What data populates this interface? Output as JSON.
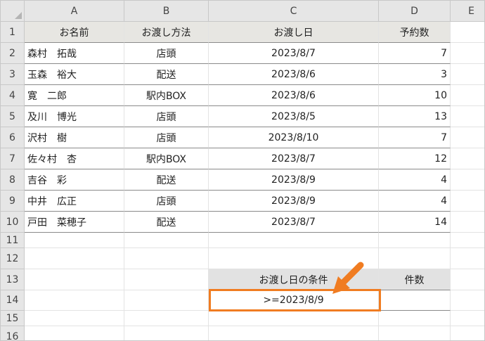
{
  "columns": [
    "A",
    "B",
    "C",
    "D",
    "E"
  ],
  "rows": [
    "1",
    "2",
    "3",
    "4",
    "5",
    "6",
    "7",
    "8",
    "9",
    "10",
    "11",
    "12",
    "13",
    "14",
    "15",
    "16"
  ],
  "table": {
    "headers": [
      "お名前",
      "お渡し方法",
      "お渡し日",
      "予約数"
    ],
    "records": [
      {
        "name": "森村　拓哉",
        "method": "店頭",
        "date": "2023/8/7",
        "count": "7"
      },
      {
        "name": "玉森　裕大",
        "method": "配送",
        "date": "2023/8/6",
        "count": "3"
      },
      {
        "name": "寛　二郎",
        "method": "駅内BOX",
        "date": "2023/8/6",
        "count": "10"
      },
      {
        "name": "及川　博光",
        "method": "店頭",
        "date": "2023/8/5",
        "count": "13"
      },
      {
        "name": "沢村　樹",
        "method": "店頭",
        "date": "2023/8/10",
        "count": "7"
      },
      {
        "name": "佐々村　杏",
        "method": "駅内BOX",
        "date": "2023/8/7",
        "count": "12"
      },
      {
        "name": "吉谷　彩",
        "method": "配送",
        "date": "2023/8/9",
        "count": "4"
      },
      {
        "name": "中井　広正",
        "method": "店頭",
        "date": "2023/8/9",
        "count": "4"
      },
      {
        "name": "戸田　菜穂子",
        "method": "配送",
        "date": "2023/8/7",
        "count": "14"
      }
    ]
  },
  "criteria": {
    "header_condition": "お渡し日の条件",
    "header_count": "件数",
    "condition_value": ">=2023/8/9",
    "count_value": ""
  },
  "colors": {
    "highlight": "#f07c21",
    "header_fill": "#e7e6e2"
  }
}
